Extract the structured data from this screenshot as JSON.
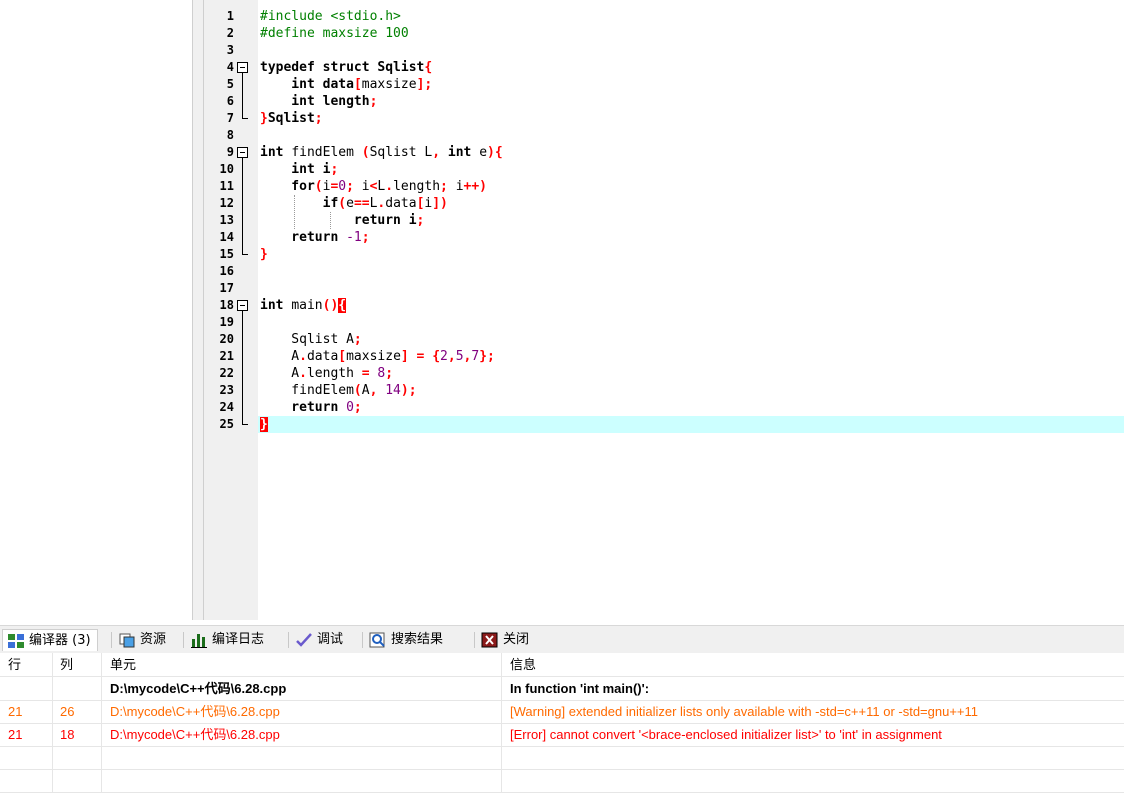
{
  "editor": {
    "active_line": 25,
    "lines": [
      {
        "n": "1",
        "segs": [
          {
            "t": "#include <stdio.h>",
            "c": "pp"
          }
        ]
      },
      {
        "n": "2",
        "segs": [
          {
            "t": "#define maxsize 100",
            "c": "pp"
          }
        ]
      },
      {
        "n": "3",
        "segs": []
      },
      {
        "n": "4",
        "fold": "start",
        "segs": [
          {
            "t": "typedef struct ",
            "c": "kw"
          },
          {
            "t": "Sqlist",
            "c": "kw"
          },
          {
            "t": "{",
            "c": "sym"
          }
        ]
      },
      {
        "n": "5",
        "segs": [
          {
            "t": "    int ",
            "c": "kw"
          },
          {
            "t": "data",
            "c": "kw"
          },
          {
            "t": "[",
            "c": "sym"
          },
          {
            "t": "maxsize",
            "c": "id"
          },
          {
            "t": "];",
            "c": "sym"
          }
        ]
      },
      {
        "n": "6",
        "segs": [
          {
            "t": "    int ",
            "c": "kw"
          },
          {
            "t": "length",
            "c": "kw"
          },
          {
            "t": ";",
            "c": "sym"
          }
        ]
      },
      {
        "n": "7",
        "fold": "end",
        "segs": [
          {
            "t": "}",
            "c": "sym"
          },
          {
            "t": "Sqlist",
            "c": "kw"
          },
          {
            "t": ";",
            "c": "sym"
          }
        ]
      },
      {
        "n": "8",
        "segs": []
      },
      {
        "n": "9",
        "fold": "start",
        "segs": [
          {
            "t": "int ",
            "c": "kw"
          },
          {
            "t": "findElem ",
            "c": "id"
          },
          {
            "t": "(",
            "c": "sym"
          },
          {
            "t": "Sqlist L",
            "c": "id"
          },
          {
            "t": ", ",
            "c": "sym"
          },
          {
            "t": "int ",
            "c": "kw"
          },
          {
            "t": "e",
            "c": "id"
          },
          {
            "t": "){",
            "c": "sym"
          }
        ]
      },
      {
        "n": "10",
        "segs": [
          {
            "t": "    int ",
            "c": "kw"
          },
          {
            "t": "i",
            "c": "kw"
          },
          {
            "t": ";",
            "c": "sym"
          }
        ]
      },
      {
        "n": "11",
        "segs": [
          {
            "t": "    for",
            "c": "kw"
          },
          {
            "t": "(",
            "c": "sym"
          },
          {
            "t": "i",
            "c": "id"
          },
          {
            "t": "=",
            "c": "sym"
          },
          {
            "t": "0",
            "c": "num"
          },
          {
            "t": "; ",
            "c": "sym"
          },
          {
            "t": "i",
            "c": "id"
          },
          {
            "t": "<",
            "c": "sym"
          },
          {
            "t": "L",
            "c": "id"
          },
          {
            "t": ".",
            "c": "sym"
          },
          {
            "t": "length",
            "c": "id"
          },
          {
            "t": "; ",
            "c": "sym"
          },
          {
            "t": "i",
            "c": "id"
          },
          {
            "t": "++)",
            "c": "sym"
          }
        ]
      },
      {
        "n": "12",
        "segs": [
          {
            "t": "        if",
            "c": "kw"
          },
          {
            "t": "(",
            "c": "sym"
          },
          {
            "t": "e",
            "c": "id"
          },
          {
            "t": "==",
            "c": "sym"
          },
          {
            "t": "L",
            "c": "id"
          },
          {
            "t": ".",
            "c": "sym"
          },
          {
            "t": "data",
            "c": "id"
          },
          {
            "t": "[",
            "c": "sym"
          },
          {
            "t": "i",
            "c": "id"
          },
          {
            "t": "])",
            "c": "sym"
          }
        ]
      },
      {
        "n": "13",
        "segs": [
          {
            "t": "            return ",
            "c": "kw"
          },
          {
            "t": "i",
            "c": "kw"
          },
          {
            "t": ";",
            "c": "sym"
          }
        ]
      },
      {
        "n": "14",
        "segs": [
          {
            "t": "    return ",
            "c": "kw"
          },
          {
            "t": "-1",
            "c": "num"
          },
          {
            "t": ";",
            "c": "sym"
          }
        ]
      },
      {
        "n": "15",
        "fold": "end",
        "segs": [
          {
            "t": "}",
            "c": "sym"
          }
        ]
      },
      {
        "n": "16",
        "segs": []
      },
      {
        "n": "17",
        "segs": []
      },
      {
        "n": "18",
        "fold": "start",
        "segs": [
          {
            "t": "int ",
            "c": "kw"
          },
          {
            "t": "main",
            "c": "id"
          },
          {
            "t": "()",
            "c": "sym"
          },
          {
            "t": "{",
            "c": "brace"
          }
        ]
      },
      {
        "n": "19",
        "segs": []
      },
      {
        "n": "20",
        "segs": [
          {
            "t": "    Sqlist A",
            "c": "id"
          },
          {
            "t": ";",
            "c": "sym"
          }
        ]
      },
      {
        "n": "21",
        "segs": [
          {
            "t": "    A",
            "c": "id"
          },
          {
            "t": ".",
            "c": "sym"
          },
          {
            "t": "data",
            "c": "id"
          },
          {
            "t": "[",
            "c": "sym"
          },
          {
            "t": "maxsize",
            "c": "id"
          },
          {
            "t": "] = {",
            "c": "sym"
          },
          {
            "t": "2",
            "c": "num"
          },
          {
            "t": ",",
            "c": "sym"
          },
          {
            "t": "5",
            "c": "num"
          },
          {
            "t": ",",
            "c": "sym"
          },
          {
            "t": "7",
            "c": "num"
          },
          {
            "t": "};",
            "c": "sym"
          }
        ]
      },
      {
        "n": "22",
        "segs": [
          {
            "t": "    A",
            "c": "id"
          },
          {
            "t": ".",
            "c": "sym"
          },
          {
            "t": "length ",
            "c": "id"
          },
          {
            "t": "= ",
            "c": "sym"
          },
          {
            "t": "8",
            "c": "num"
          },
          {
            "t": ";",
            "c": "sym"
          }
        ]
      },
      {
        "n": "23",
        "segs": [
          {
            "t": "    findElem",
            "c": "id"
          },
          {
            "t": "(",
            "c": "sym"
          },
          {
            "t": "A",
            "c": "id"
          },
          {
            "t": ", ",
            "c": "sym"
          },
          {
            "t": "14",
            "c": "num"
          },
          {
            "t": ");",
            "c": "sym"
          }
        ]
      },
      {
        "n": "24",
        "segs": [
          {
            "t": "    return ",
            "c": "kw"
          },
          {
            "t": "0",
            "c": "num"
          },
          {
            "t": ";",
            "c": "sym"
          }
        ]
      },
      {
        "n": "25",
        "fold": "end",
        "segs": [
          {
            "t": "}",
            "c": "brace"
          }
        ]
      }
    ]
  },
  "tabs": [
    {
      "label": "编译器 (3)",
      "icon": "grid-icon",
      "active": true
    },
    {
      "label": "资源",
      "icon": "resources-icon",
      "active": false
    },
    {
      "label": "编译日志",
      "icon": "bar-chart-icon",
      "active": false
    },
    {
      "label": "调试",
      "icon": "checkmark-icon",
      "active": false
    },
    {
      "label": "搜索结果",
      "icon": "search-icon",
      "active": false
    },
    {
      "label": "关闭",
      "icon": "close-icon",
      "active": false
    }
  ],
  "messages": {
    "headers": {
      "line": "行",
      "col": "列",
      "unit": "单元",
      "msg": "信息"
    },
    "rows": [
      {
        "type": "bold",
        "line": "",
        "col": "",
        "unit": "D:\\mycode\\C++代码\\6.28.cpp",
        "msg": "In function 'int main()':"
      },
      {
        "type": "warn",
        "line": "21",
        "col": "26",
        "unit": "D:\\mycode\\C++代码\\6.28.cpp",
        "msg": "[Warning] extended initializer lists only available with -std=c++11 or -std=gnu++11"
      },
      {
        "type": "err",
        "line": "21",
        "col": "18",
        "unit": "D:\\mycode\\C++代码\\6.28.cpp",
        "msg": "[Error] cannot convert '<brace-enclosed initializer list>' to 'int' in assignment"
      },
      {
        "type": "empty",
        "line": "",
        "col": "",
        "unit": "",
        "msg": ""
      },
      {
        "type": "empty",
        "line": "",
        "col": "",
        "unit": "",
        "msg": ""
      }
    ]
  },
  "colors": {
    "warning": "#ff6a00",
    "error": "#ff0000",
    "active_line": "#ccffff",
    "brace_match": "#ff0000"
  }
}
